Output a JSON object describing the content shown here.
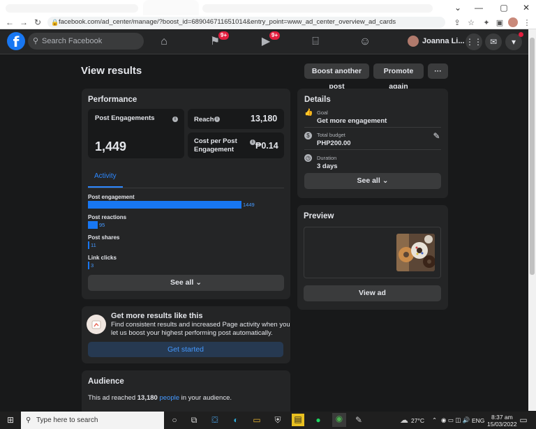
{
  "browser": {
    "url": "facebook.com/ad_center/manage/?boost_id=689046711651014&entry_point=www_ad_center_overview_ad_cards"
  },
  "fbnav": {
    "search_placeholder": "Search Facebook",
    "badge_groups": "9+",
    "badge_watch": "9+",
    "user_name": "Joanna Li..."
  },
  "page": {
    "title": "View results",
    "boost_another": "Boost another post",
    "promote_again": "Promote again",
    "more": "···"
  },
  "performance": {
    "title": "Performance",
    "post_engagements_label": "Post Engagements",
    "post_engagements_value": "1,449",
    "reach_label": "Reach",
    "reach_value": "13,180",
    "cpe_label_1": "Cost per Post",
    "cpe_label_2": "Engagement",
    "cpe_value": "₱0.14",
    "tab_activity": "Activity",
    "metrics": [
      {
        "label": "Post engagement",
        "value": 1449,
        "display": "1449"
      },
      {
        "label": "Post reactions",
        "value": 95,
        "display": "95"
      },
      {
        "label": "Post shares",
        "value": 11,
        "display": "11"
      },
      {
        "label": "Link clicks",
        "value": 3,
        "display": "3"
      }
    ],
    "see_all": "See all"
  },
  "details": {
    "title": "Details",
    "goal_label": "Goal",
    "goal_value": "Get more engagement",
    "budget_label": "Total budget",
    "budget_value": "PHP200.00",
    "duration_label": "Duration",
    "duration_value": "3 days",
    "see_all": "See all"
  },
  "preview": {
    "title": "Preview",
    "view_ad": "View ad"
  },
  "promo": {
    "title": "Get more results like this",
    "line1": "Find consistent results and increased Page activity when you",
    "line2": "let us boost your highest performing post automatically.",
    "cta": "Get started"
  },
  "audience": {
    "title": "Audience",
    "text_before": "This ad reached",
    "reach": "13,180",
    "link": "people",
    "text_after": "in your audience."
  },
  "taskbar": {
    "search_placeholder": "Type here to search",
    "temperature": "27°C",
    "language": "ENG",
    "time": "8:37 am",
    "date": "15/03/2022"
  }
}
